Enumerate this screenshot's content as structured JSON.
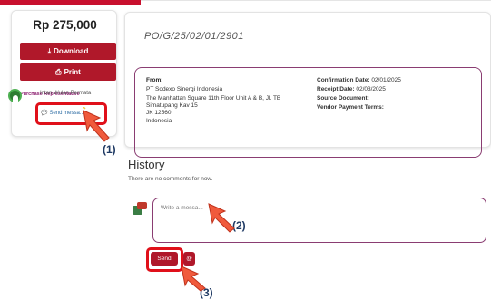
{
  "summary": {
    "price": "Rp 275,000",
    "download_label": "Download",
    "print_label": "Print",
    "purchase_rep_label": "Purchase Representative",
    "rep_name": "Intan Wulan Permata",
    "send_message_label": "Send messa..."
  },
  "order": {
    "po_number": "PO/G/25/02/01/2901",
    "from_label": "From:",
    "from_lines": [
      "PT Sodexo Sinergi Indonesia",
      "The Manhattan Square 11th Floor Unit A & B, Jl. TB",
      "Simatupang Kav 15",
      "JK 12560",
      "Indonesia"
    ],
    "confirmation_date_label": "Confirmation Date:",
    "confirmation_date": "02/01/2025",
    "receipt_date_label": "Receipt Date:",
    "receipt_date": "02/03/2025",
    "source_document_label": "Source Document:",
    "vendor_payment_terms_label": "Vendor Payment Terms:"
  },
  "history": {
    "title": "History",
    "empty_text": "There are no comments for now.",
    "comment_placeholder": "Write a messa...",
    "send_label": "Send",
    "attach_label": "@"
  },
  "annotations": {
    "step1": "(1)",
    "step2": "(2)",
    "step3": "(3)"
  },
  "colors": {
    "brand_red": "#b0182a",
    "highlight_red": "#e0101a",
    "border_purple": "#8a3d72",
    "annotation_blue": "#1f3a64"
  }
}
